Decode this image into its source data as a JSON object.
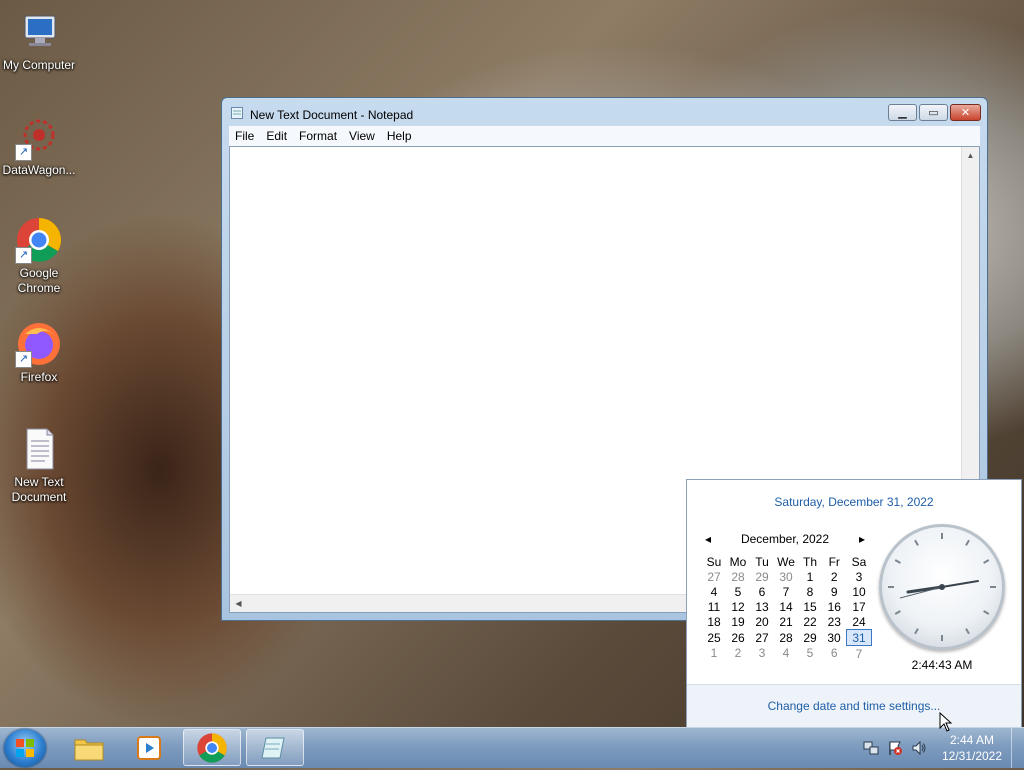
{
  "desktop": {
    "icons": [
      {
        "label": "My Computer"
      },
      {
        "label": "DataWagon..."
      },
      {
        "label": "Google Chrome"
      },
      {
        "label": "Firefox"
      },
      {
        "label": "New Text Document"
      }
    ]
  },
  "notepad": {
    "title": "New Text Document - Notepad",
    "menu": [
      "File",
      "Edit",
      "Format",
      "View",
      "Help"
    ],
    "content": ""
  },
  "calendar": {
    "long_date": "Saturday, December 31, 2022",
    "month_label": "December, 2022",
    "weekdays": [
      "Su",
      "Mo",
      "Tu",
      "We",
      "Th",
      "Fr",
      "Sa"
    ],
    "weeks": [
      [
        "27",
        "28",
        "29",
        "30",
        "1",
        "2",
        "3"
      ],
      [
        "4",
        "5",
        "6",
        "7",
        "8",
        "9",
        "10"
      ],
      [
        "11",
        "12",
        "13",
        "14",
        "15",
        "16",
        "17"
      ],
      [
        "18",
        "19",
        "20",
        "21",
        "22",
        "23",
        "24"
      ],
      [
        "25",
        "26",
        "27",
        "28",
        "29",
        "30",
        "31"
      ],
      [
        "1",
        "2",
        "3",
        "4",
        "5",
        "6",
        "7"
      ]
    ],
    "time": "2:44:43 AM",
    "settings_link": "Change date and time settings..."
  },
  "taskbar": {
    "clock_time": "2:44 AM",
    "clock_date": "12/31/2022"
  },
  "colors": {
    "link_blue": "#1f5ea8",
    "close_red": "#c8442e"
  }
}
